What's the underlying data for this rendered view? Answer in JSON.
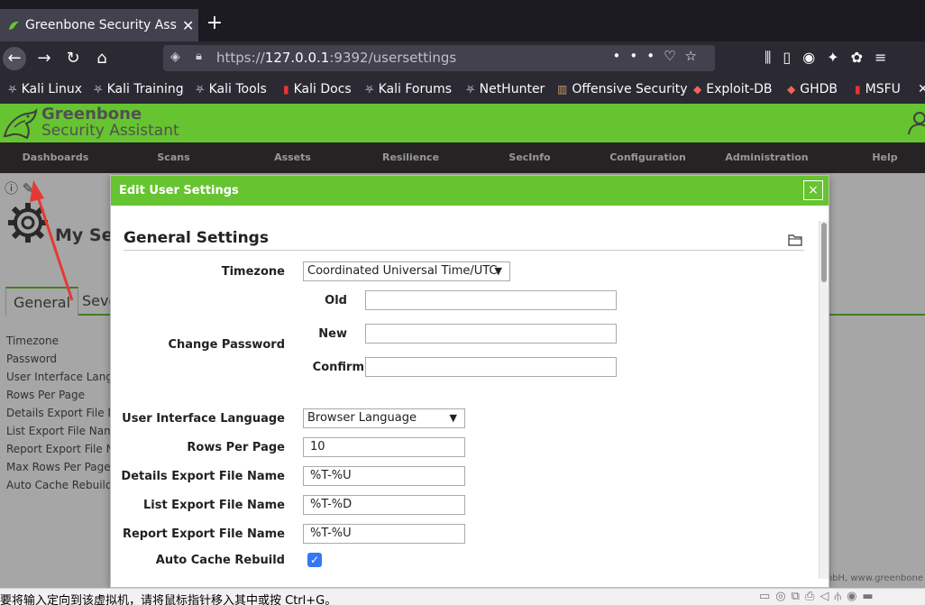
{
  "browser": {
    "tab_title": "Greenbone Security Assis",
    "new_tab": "+",
    "url_prefix": "https://",
    "url_host": "127.0.0.1",
    "url_rest": ":9392/usersettings",
    "bookmarks": [
      "Kali Linux",
      "Kali Training",
      "Kali Tools",
      "Kali Docs",
      "Kali Forums",
      "NetHunter",
      "Offensive Security",
      "Exploit-DB",
      "GHDB",
      "MSFU"
    ]
  },
  "app": {
    "logo_line1": "Greenbone",
    "logo_line2": "Security Assistant",
    "menu": [
      "Dashboards",
      "Scans",
      "Assets",
      "Resilience",
      "SecInfo",
      "Configuration",
      "Administration",
      "Help"
    ],
    "page_title": "My Sett",
    "tabs": [
      "General",
      "Seve"
    ],
    "settings_list": [
      "Timezone",
      "Password",
      "User Interface Langu",
      "Rows Per Page",
      "Details Export File Na",
      "List Export File Name",
      "Report Export File Na",
      "Max Rows Per Page (",
      "Auto Cache Rebuild"
    ],
    "footer": "mbH, www.greenbone"
  },
  "dialog": {
    "title": "Edit User Settings",
    "close": "×",
    "section_title": "General Settings",
    "timezone_label": "Timezone",
    "timezone_value": "Coordinated Universal Time/UTC",
    "change_password_label": "Change Password",
    "old_label": "Old",
    "new_label": "New",
    "confirm_label": "Confirm",
    "ui_language_label": "User Interface Language",
    "ui_language_value": "Browser Language",
    "rows_per_page_label": "Rows Per Page",
    "rows_per_page_value": "10",
    "details_export_label": "Details Export File Name",
    "details_export_value": "%T-%U",
    "list_export_label": "List Export File Name",
    "list_export_value": "%T-%D",
    "report_export_label": "Report Export File Name",
    "report_export_value": "%T-%U",
    "auto_cache_label": "Auto Cache Rebuild",
    "auto_cache_checked": true
  },
  "statusbar": {
    "message": "要将输入定向到该虚拟机，请将鼠标指针移入其中或按 Ctrl+G。"
  },
  "colors": {
    "gsa_green": "#66c430",
    "menu_bg": "#393637",
    "browser_dark": "#2b2a33",
    "annotation_arrow": "#e53935"
  }
}
